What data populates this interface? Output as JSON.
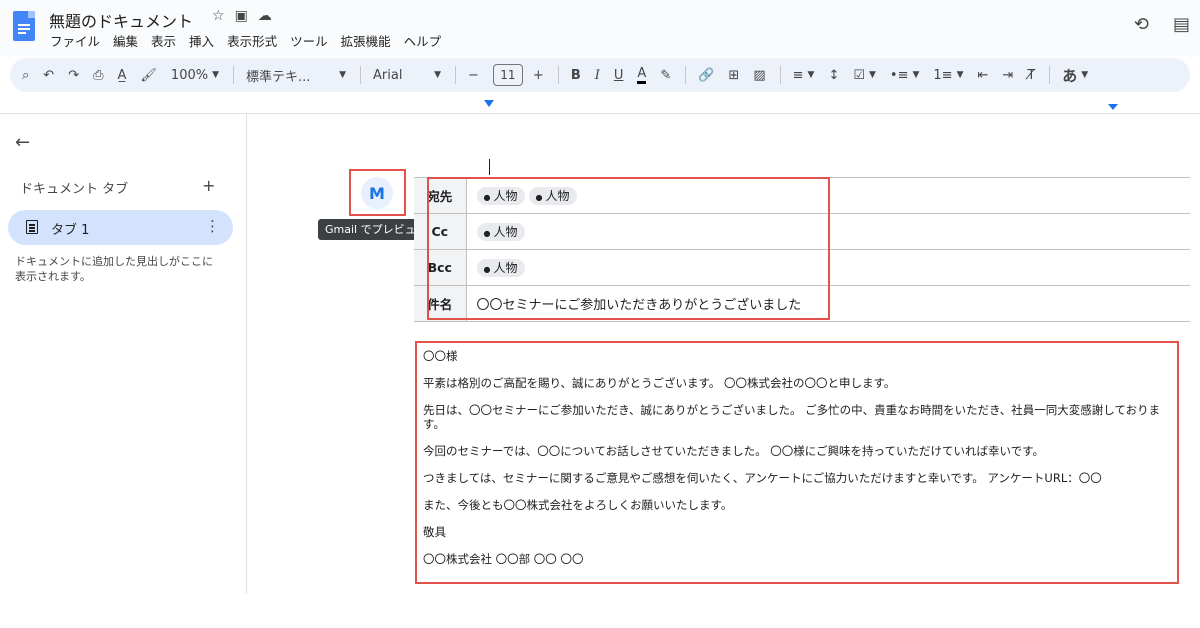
{
  "doc": {
    "title": "無題のドキュメント",
    "menu": [
      "ファイル",
      "編集",
      "表示",
      "挿入",
      "表示形式",
      "ツール",
      "拡張機能",
      "ヘルプ"
    ]
  },
  "toolbar": {
    "zoom": "100%",
    "style": "標準テキ...",
    "font": "Arial",
    "font_size": "11",
    "input_tools": "あ"
  },
  "sidebar": {
    "section_title": "ドキュメント タブ",
    "tab_label": "タブ 1",
    "note": "ドキュメントに追加した見出しがここに表示されます。"
  },
  "gmail": {
    "tooltip": "Gmail でプレビュー"
  },
  "email": {
    "to_label": "宛先",
    "cc_label": "Cc",
    "bcc_label": "Bcc",
    "subject_label": "件名",
    "person_chip": "人物",
    "subject": "〇〇セミナーにご参加いただきありがとうございました"
  },
  "body": {
    "lines": [
      "〇〇様",
      "平素は格別のご高配を賜り、誠にありがとうございます。 〇〇株式会社の〇〇と申します。",
      "先日は、〇〇セミナーにご参加いただき、誠にありがとうございました。 ご多忙の中、貴重なお時間をいただき、社員一同大変感謝しております。",
      "今回のセミナーでは、〇〇についてお話しさせていただきました。 〇〇様にご興味を持っていただけていれば幸いです。",
      "つきましては、セミナーに関するご意見やご感想を伺いたく、アンケートにご協力いただけますと幸いです。 アンケートURL：〇〇",
      "また、今後とも〇〇株式会社をよろしくお願いいたします。",
      "敬具",
      "〇〇株式会社 〇〇部 〇〇 〇〇"
    ]
  }
}
